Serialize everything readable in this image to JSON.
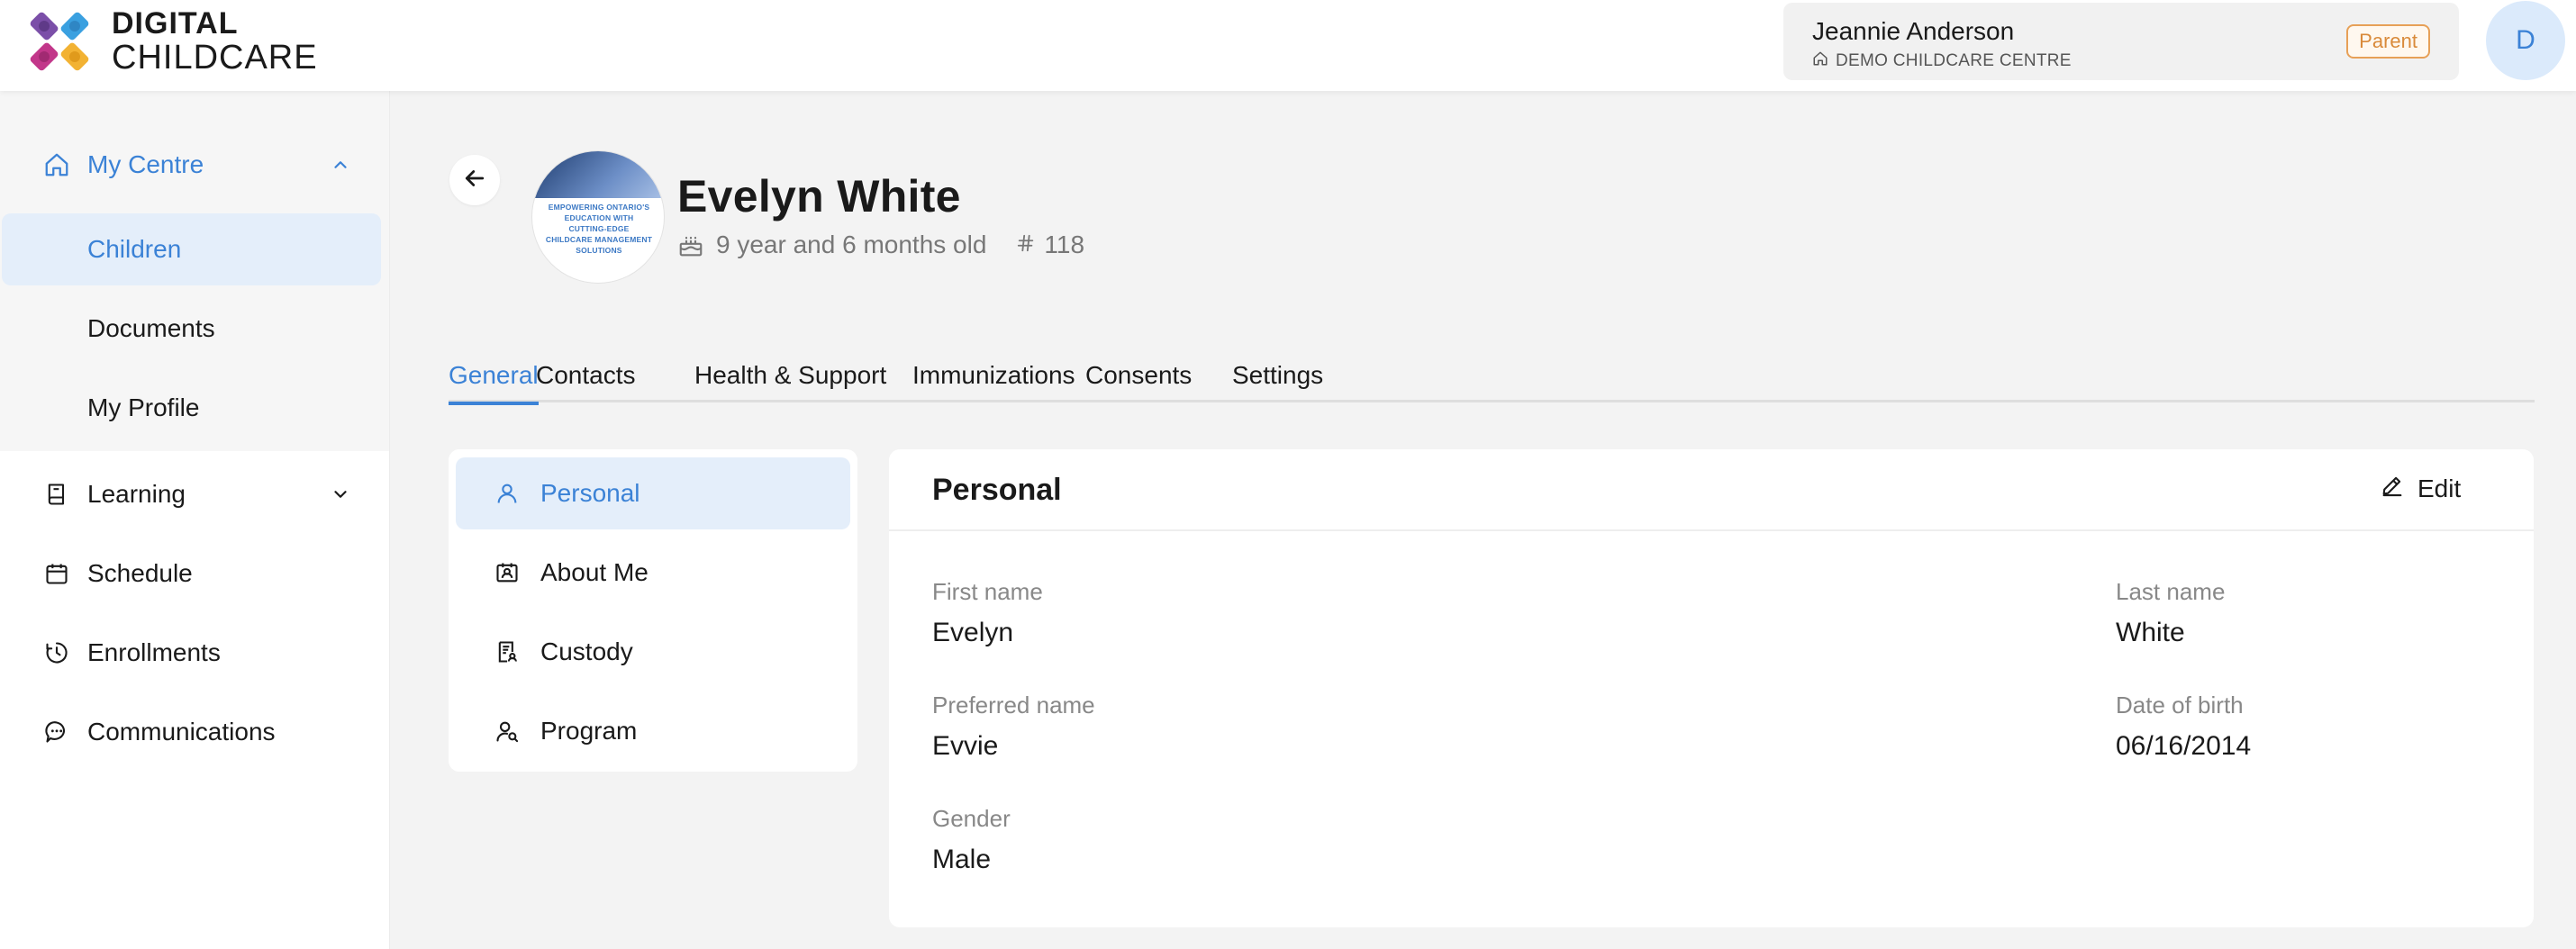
{
  "app": {
    "logo_line1": "DIGITAL",
    "logo_line2": "CHILDCARE"
  },
  "user": {
    "name": "Jeannie Anderson",
    "centre": "DEMO CHILDCARE CENTRE",
    "role": "Parent",
    "avatar_initial": "D"
  },
  "sidebar": {
    "items": [
      {
        "label": "My Centre",
        "icon": "home-icon"
      },
      {
        "label": "Children"
      },
      {
        "label": "Documents"
      },
      {
        "label": "My Profile"
      },
      {
        "label": "Learning",
        "icon": "book-icon"
      },
      {
        "label": "Schedule",
        "icon": "calendar-icon"
      },
      {
        "label": "Enrollments",
        "icon": "clock-icon"
      },
      {
        "label": "Communications",
        "icon": "chat-icon"
      }
    ]
  },
  "child": {
    "name": "Evelyn White",
    "age": "9 year and 6 months old",
    "id": "118",
    "photo_text": "EMPOWERING ONTARIO'S EDUCATION WITH CUTTING-EDGE CHILDCARE MANAGEMENT SOLUTIONS"
  },
  "tabs": [
    {
      "label": "General"
    },
    {
      "label": "Contacts"
    },
    {
      "label": "Health & Support"
    },
    {
      "label": "Immunizations"
    },
    {
      "label": "Consents"
    },
    {
      "label": "Settings"
    }
  ],
  "subnav": [
    {
      "label": "Personal",
      "icon": "person-icon"
    },
    {
      "label": "About Me",
      "icon": "id-card-icon"
    },
    {
      "label": "Custody",
      "icon": "document-person-icon"
    },
    {
      "label": "Program",
      "icon": "person-search-icon"
    }
  ],
  "panel": {
    "title": "Personal",
    "edit_label": "Edit",
    "fields": {
      "first_name": {
        "label": "First name",
        "value": "Evelyn"
      },
      "last_name": {
        "label": "Last name",
        "value": "White"
      },
      "preferred_name": {
        "label": "Preferred name",
        "value": "Evvie"
      },
      "dob": {
        "label": "Date of birth",
        "value": "06/16/2014"
      },
      "gender": {
        "label": "Gender",
        "value": "Male"
      }
    }
  },
  "colors": {
    "accent": "#3b82d6",
    "badge": "#d98a3a",
    "active_bg": "#e4eefa"
  }
}
